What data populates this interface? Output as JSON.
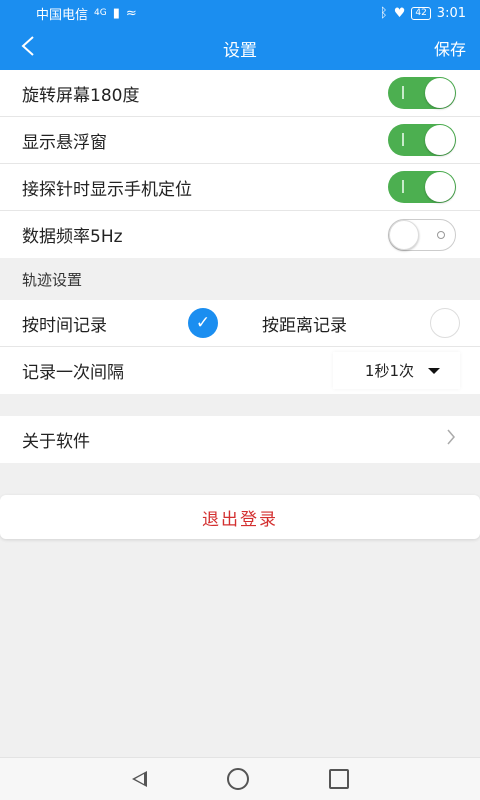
{
  "statusbar": {
    "carrier": "中国电信",
    "network": "4G",
    "battery": "42",
    "time": "3:01"
  },
  "appbar": {
    "title": "设置",
    "save_label": "保存"
  },
  "settings": {
    "rotate_label": "旋转屏幕180度",
    "rotate_on": true,
    "float_label": "显示悬浮窗",
    "float_on": true,
    "probe_location_label": "接探针时显示手机定位",
    "probe_location_on": true,
    "freq_label": "数据频率5Hz",
    "freq_on": false
  },
  "track": {
    "section_title": "轨迹设置",
    "by_time_label": "按时间记录",
    "by_time_selected": true,
    "by_distance_label": "按距离记录",
    "by_distance_selected": false,
    "interval_label": "记录一次间隔",
    "interval_value": "1秒1次"
  },
  "about": {
    "label": "关于软件"
  },
  "logout": {
    "label": "退出登录"
  },
  "colors": {
    "primary": "#1b8ef0",
    "switch_on": "#4caf50",
    "logout_text": "#d32f2f"
  }
}
